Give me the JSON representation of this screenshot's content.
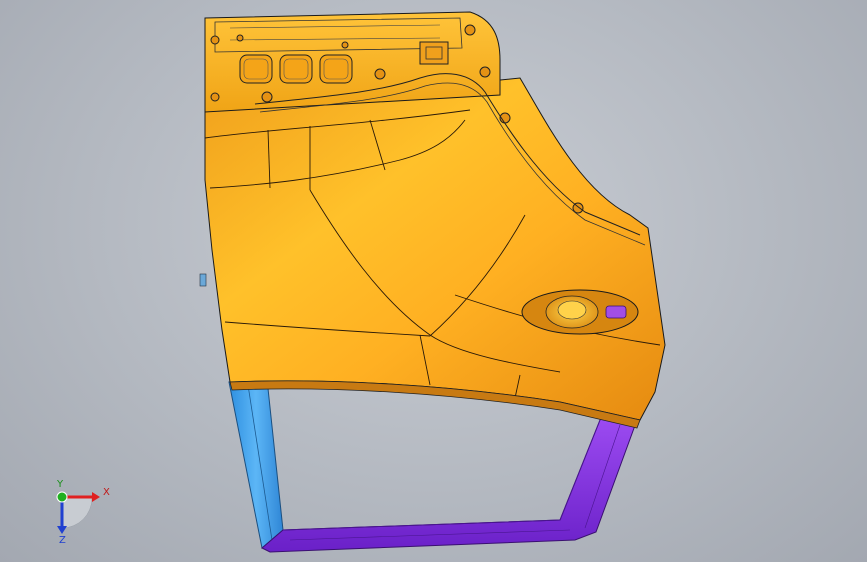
{
  "viewport": {
    "background": "#b4b9c1",
    "model": "door-panel-3d-model"
  },
  "triad": {
    "x_label": "X",
    "y_label": "Y",
    "z_label": "Z",
    "x_color": "#e02020",
    "y_color": "#20b020",
    "z_color": "#2040d0"
  },
  "colors": {
    "panel": "#f7a818",
    "panel_dark": "#e48a0a",
    "frame_left": "#3aa0ee",
    "frame_bottom": "#8a30e8",
    "edge": "#1a1a1a"
  }
}
